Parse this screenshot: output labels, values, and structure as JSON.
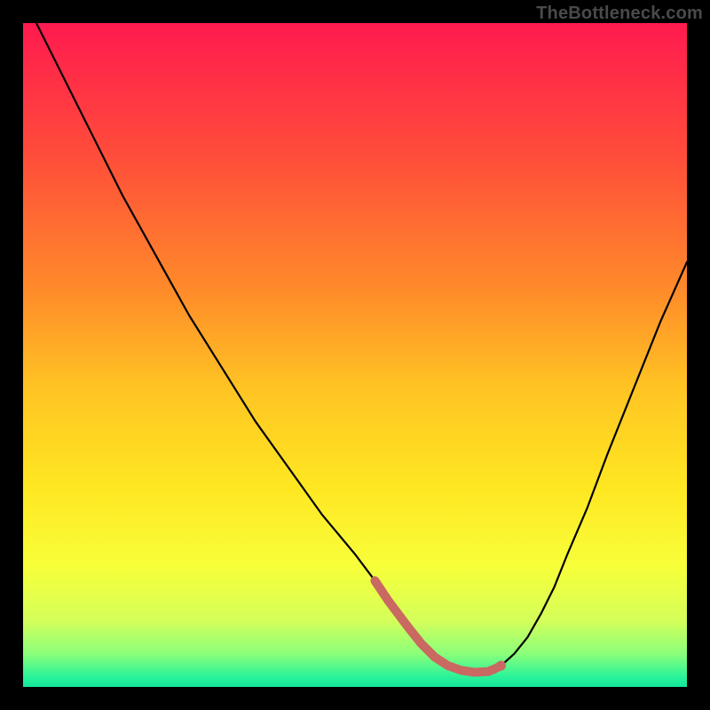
{
  "watermark": "TheBottleneck.com",
  "chart_data": {
    "type": "line",
    "title": "",
    "xlabel": "",
    "ylabel": "",
    "xlim": [
      0,
      100
    ],
    "ylim": [
      0,
      100
    ],
    "gradient_stops": [
      {
        "offset": 0.0,
        "color": "#ff1a4f"
      },
      {
        "offset": 0.2,
        "color": "#ff4d3a"
      },
      {
        "offset": 0.4,
        "color": "#ff8a2a"
      },
      {
        "offset": 0.55,
        "color": "#ffc423"
      },
      {
        "offset": 0.7,
        "color": "#ffe722"
      },
      {
        "offset": 0.82,
        "color": "#f7ff3a"
      },
      {
        "offset": 0.9,
        "color": "#d4ff5a"
      },
      {
        "offset": 0.95,
        "color": "#8bff7a"
      },
      {
        "offset": 0.985,
        "color": "#29f39a"
      },
      {
        "offset": 1.0,
        "color": "#13e79a"
      }
    ],
    "series": [
      {
        "name": "bottleneck-curve",
        "x": [
          2,
          5,
          10,
          15,
          20,
          25,
          30,
          35,
          40,
          45,
          50,
          53,
          55,
          58,
          60,
          62,
          64,
          66,
          68,
          70,
          72,
          74,
          76,
          78,
          80,
          82,
          85,
          88,
          92,
          96,
          100
        ],
        "y": [
          100,
          94,
          84,
          74,
          65,
          56,
          48,
          40,
          33,
          26,
          20,
          16,
          13,
          9,
          6.5,
          4.5,
          3.2,
          2.5,
          2.2,
          2.3,
          3.2,
          5.0,
          7.5,
          11,
          15,
          20,
          27,
          35,
          45,
          55,
          64
        ]
      }
    ],
    "highlighted_range": {
      "x": [
        53,
        55,
        58,
        60,
        62,
        64,
        66,
        68,
        69,
        70,
        71,
        72
      ],
      "y": [
        16,
        13,
        9,
        6.5,
        4.5,
        3.2,
        2.5,
        2.2,
        2.25,
        2.3,
        2.7,
        3.2
      ]
    },
    "highlight_marker": {
      "x": 72,
      "y": 3.2
    }
  }
}
